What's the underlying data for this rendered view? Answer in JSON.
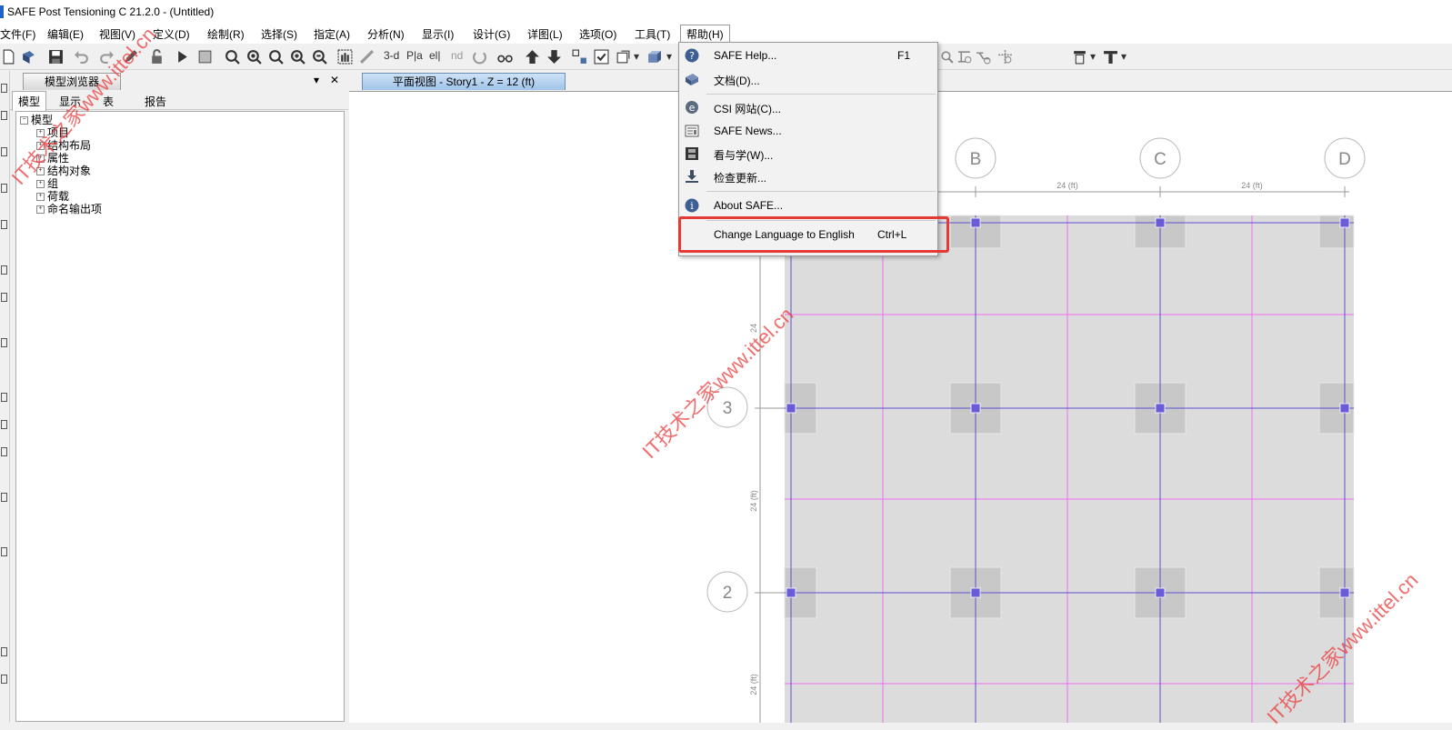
{
  "window": {
    "title": "SAFE Post Tensioning C 21.2.0 - (Untitled)"
  },
  "menubar": {
    "items": [
      "文件(F)",
      "编辑(E)",
      "视图(V)",
      "定义(D)",
      "绘制(R)",
      "选择(S)",
      "指定(A)",
      "分析(N)",
      "显示(I)",
      "设计(G)",
      "详图(L)",
      "选项(O)",
      "工具(T)",
      "帮助(H)"
    ]
  },
  "toolbar": {
    "btn_3d": "3-d",
    "btn_nd": "nd"
  },
  "model_browser": {
    "title": "模型浏览器",
    "tabs": [
      "模型",
      "显示",
      "表",
      "报告"
    ],
    "root": "模型",
    "nodes": [
      "项目",
      "结构布局",
      "属性",
      "结构对象",
      "组",
      "荷载",
      "命名输出项"
    ]
  },
  "view": {
    "tab": "平面视图 - Story1 - Z = 12 (ft)",
    "grid_labels_x": [
      "B",
      "C",
      "D"
    ],
    "grid_labels_y": [
      "3",
      "2"
    ],
    "dim_label": "24 (ft)"
  },
  "help_menu": {
    "items": [
      {
        "label": "SAFE Help...",
        "shortcut": "F1",
        "icon": "question-icon"
      },
      {
        "label": "文档(D)...",
        "shortcut": "",
        "icon": "book-icon"
      },
      {
        "label": "CSI 网站(C)...",
        "shortcut": "",
        "icon": "web-icon"
      },
      {
        "label": "SAFE News...",
        "shortcut": "",
        "icon": "news-icon"
      },
      {
        "label": "看与学(W)...",
        "shortcut": "",
        "icon": "film-icon"
      },
      {
        "label": "检查更新...",
        "shortcut": "",
        "icon": "download-icon"
      },
      {
        "label": "About SAFE...",
        "shortcut": "",
        "icon": "info-icon"
      },
      {
        "label": "Change Language to English",
        "shortcut": "Ctrl+L",
        "icon": ""
      }
    ]
  },
  "watermark": {
    "text": "IT技术之家www.ittel.cn"
  },
  "colors": {
    "highlight": "#e53935",
    "grid_line": "#5b4fcf",
    "magenta_line": "#f06ef0",
    "slab": "#dcdcdc",
    "column": "#c8c8c8"
  }
}
